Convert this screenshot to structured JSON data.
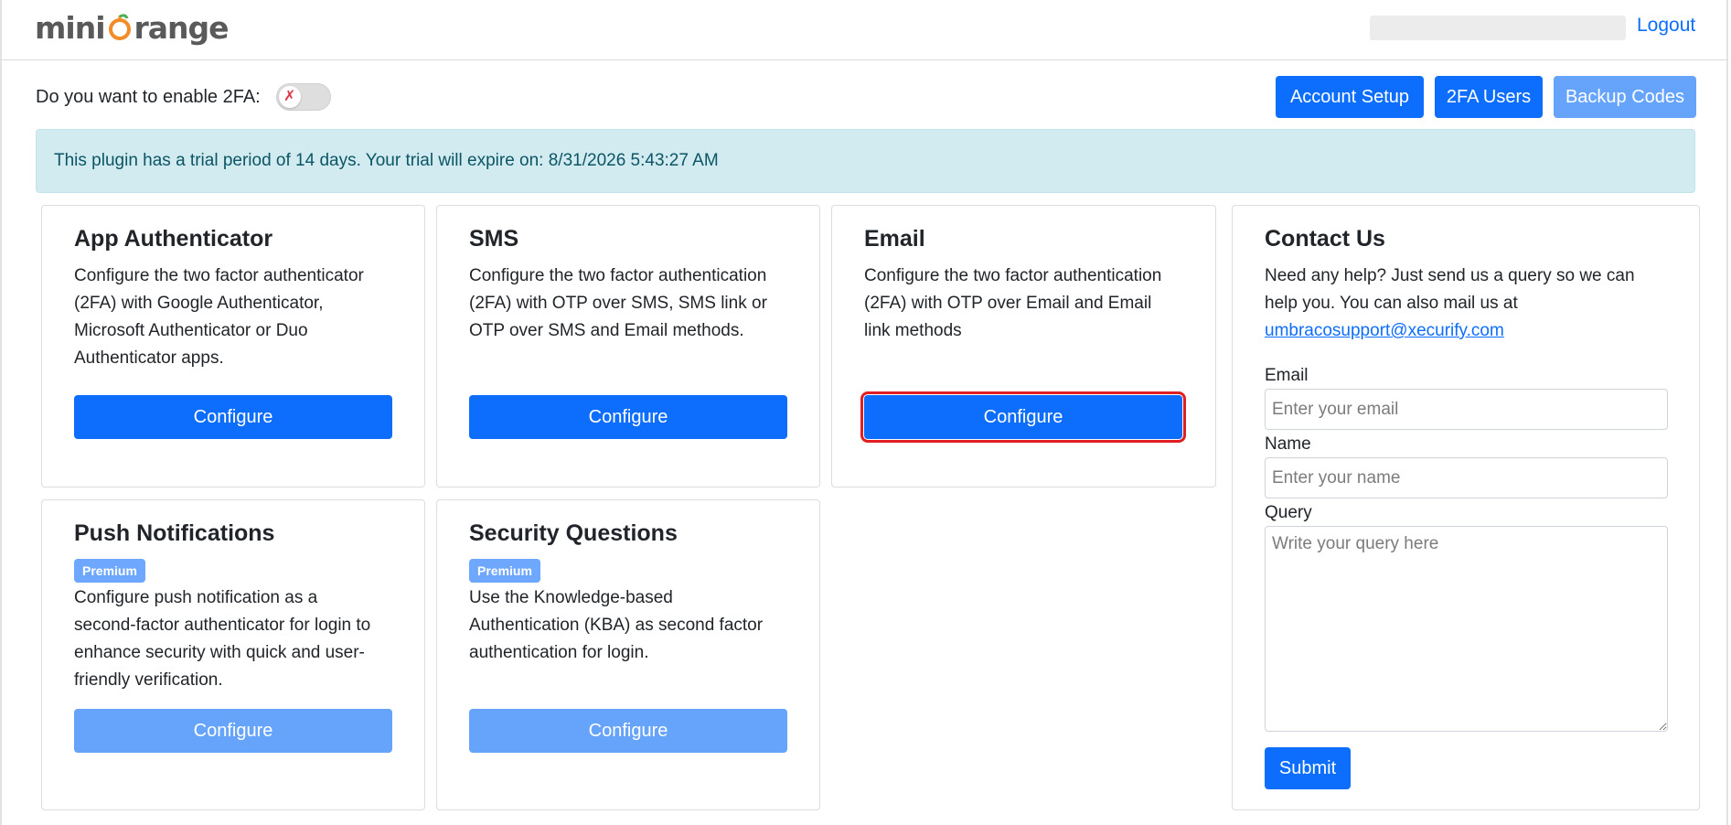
{
  "header": {
    "logo_text_left": "mini",
    "logo_text_right": "range",
    "logout": "Logout"
  },
  "toolbar": {
    "toggle_label": "Do you want to enable 2FA:",
    "toggle_icon": "x-mark-icon",
    "account_setup": "Account Setup",
    "twofa_users": "2FA Users",
    "backup_codes": "Backup Codes"
  },
  "alert": {
    "text": "This plugin has a trial period of 14 days. Your trial will expire on: 8/31/2026 5:43:27 AM"
  },
  "methods": [
    {
      "title": "App Authenticator",
      "description": "Configure the two factor authenticator (2FA) with Google Authenticator, Microsoft Authenticator or Duo Authenticator apps.",
      "button": "Configure"
    },
    {
      "title": "SMS",
      "description": "Configure the two factor authentication (2FA) with OTP over SMS, SMS link or OTP over SMS and Email methods.",
      "button": "Configure"
    },
    {
      "title": "Email",
      "description": "Configure the two factor authentication (2FA) with OTP over Email and Email link methods",
      "button": "Configure"
    },
    {
      "title": "Push Notifications",
      "badge": "Premium",
      "description": "Configure push notification as a second-factor authenticator for login to enhance security with quick and user-friendly verification.",
      "button": "Configure"
    },
    {
      "title": "Security Questions",
      "badge": "Premium",
      "description": "Use the Knowledge-based Authentication (KBA) as second factor authentication for login.",
      "button": "Configure"
    }
  ],
  "contact": {
    "title": "Contact Us",
    "intro": "Need any help? Just send us a query so we can help you. You can also mail us at",
    "email_link": "umbracosupport@xecurify.com",
    "email_label": "Email",
    "email_placeholder": "Enter your email",
    "name_label": "Name",
    "name_placeholder": "Enter your name",
    "query_label": "Query",
    "query_placeholder": "Write your query here",
    "submit": "Submit"
  },
  "colors": {
    "primary": "#0d6efd",
    "primary_disabled": "#66a3fb",
    "alert_bg": "#d1ebf0",
    "logo_accent": "#f28c28"
  }
}
